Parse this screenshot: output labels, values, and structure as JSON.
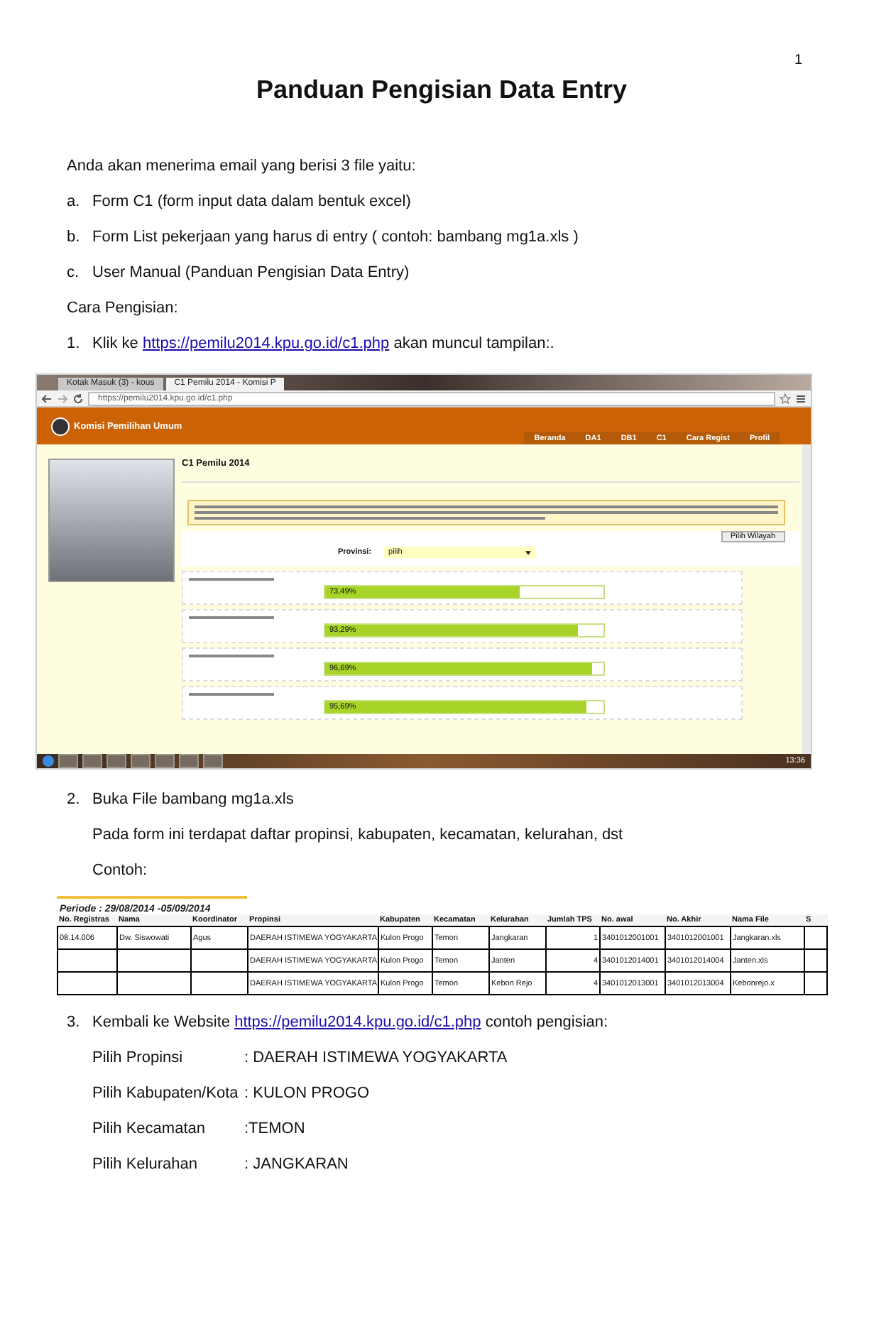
{
  "page_number": "1",
  "title": "Panduan Pengisian Data Entry",
  "intro": "Anda akan menerima email yang berisi 3 file yaitu:",
  "files": [
    {
      "marker": "a.",
      "text": "Form C1 (form input data dalam bentuk excel)"
    },
    {
      "marker": "b.",
      "text": "Form List pekerjaan yang harus di entry ( contoh: bambang mg1a.xls )"
    },
    {
      "marker": "c.",
      "text": "User Manual (Panduan Pengisian Data Entry)"
    }
  ],
  "steps_heading": "Cara Pengisian:",
  "step1": {
    "number": "1.",
    "before": "Klik ke",
    "link": "https://pemilu2014.kpu.go.id/c1.php",
    "after": "akan muncul tampilan:."
  },
  "browser": {
    "tabs": [
      {
        "label": "Kotak Masuk (3) - kous",
        "selected": false
      },
      {
        "label": "C1 Pemilu 2014 - Komisi P",
        "selected": true
      }
    ],
    "url": "https://pemilu2014.kpu.go.id/c1.php",
    "site_title": "Komisi Pemilihan Umum",
    "nav": [
      "Beranda",
      "DA1",
      "DB1",
      "C1",
      "Cara Regist",
      "Profil"
    ],
    "heading": "C1 Pemilu 2014",
    "region_button": "Pilih Wilayah",
    "province_label": "Provinsi:",
    "province_value": "pilih",
    "progress": [
      {
        "reading": "73,49%",
        "level": 0.7
      },
      {
        "reading": "93,29%",
        "level": 0.91
      },
      {
        "reading": "96,69%",
        "level": 0.96
      },
      {
        "reading": "95,69%",
        "level": 0.94
      }
    ],
    "clock": "13:36"
  },
  "step2": {
    "number": "2.",
    "text": "Buka File bambang mg1a.xls",
    "detail": "Pada form ini terdapat daftar propinsi, kabupaten, kecamatan, kelurahan, dst",
    "example": "Contoh:"
  },
  "sheet": {
    "period": "Periode : 29/08/2014 -05/09/2014",
    "columns": [
      "No. Registras",
      "Nama",
      "Koordinator",
      "Propinsi",
      "Kabupaten",
      "Kecamatan",
      "Kelurahan",
      "Jumlah TPS",
      "No. awal",
      "No. Akhir",
      "Nama File",
      "S"
    ],
    "rows": [
      [
        "08.14.006",
        "Dw. Siswowati",
        "Agus",
        "DAERAH ISTIMEWA YOGYAKARTA",
        "Kulon Progo",
        "Temon",
        "Jangkaran",
        "1",
        "3401012001001",
        "3401012001001",
        "Jangkaran.xls",
        ""
      ],
      [
        "",
        "",
        "",
        "DAERAH ISTIMEWA YOGYAKARTA",
        "Kulon Progo",
        "Temon",
        "Janten",
        "4",
        "3401012014001",
        "3401012014004",
        "Janten.xls",
        ""
      ],
      [
        "",
        "",
        "",
        "DAERAH ISTIMEWA YOGYAKARTA",
        "Kulon Progo",
        "Temon",
        "Kebon Rejo",
        "4",
        "3401012013001",
        "3401012013004",
        "Kebonrejo.x",
        ""
      ]
    ]
  },
  "step3": {
    "number": "3.",
    "before": "Kembali ke Website",
    "link": "https://pemilu2014.kpu.go.id/c1.php",
    "after": "contoh pengisian:"
  },
  "choices": [
    {
      "label": "Pilih Propinsi",
      "value": ": DAERAH ISTIMEWA YOGYAKARTA"
    },
    {
      "label": "Pilih Kabupaten/Kota",
      "value": ": KULON PROGO"
    },
    {
      "label": "Pilih Kecamatan",
      "value": ":TEMON"
    },
    {
      "label": "Pilih Kelurahan",
      "value": ": JANGKARAN"
    }
  ]
}
